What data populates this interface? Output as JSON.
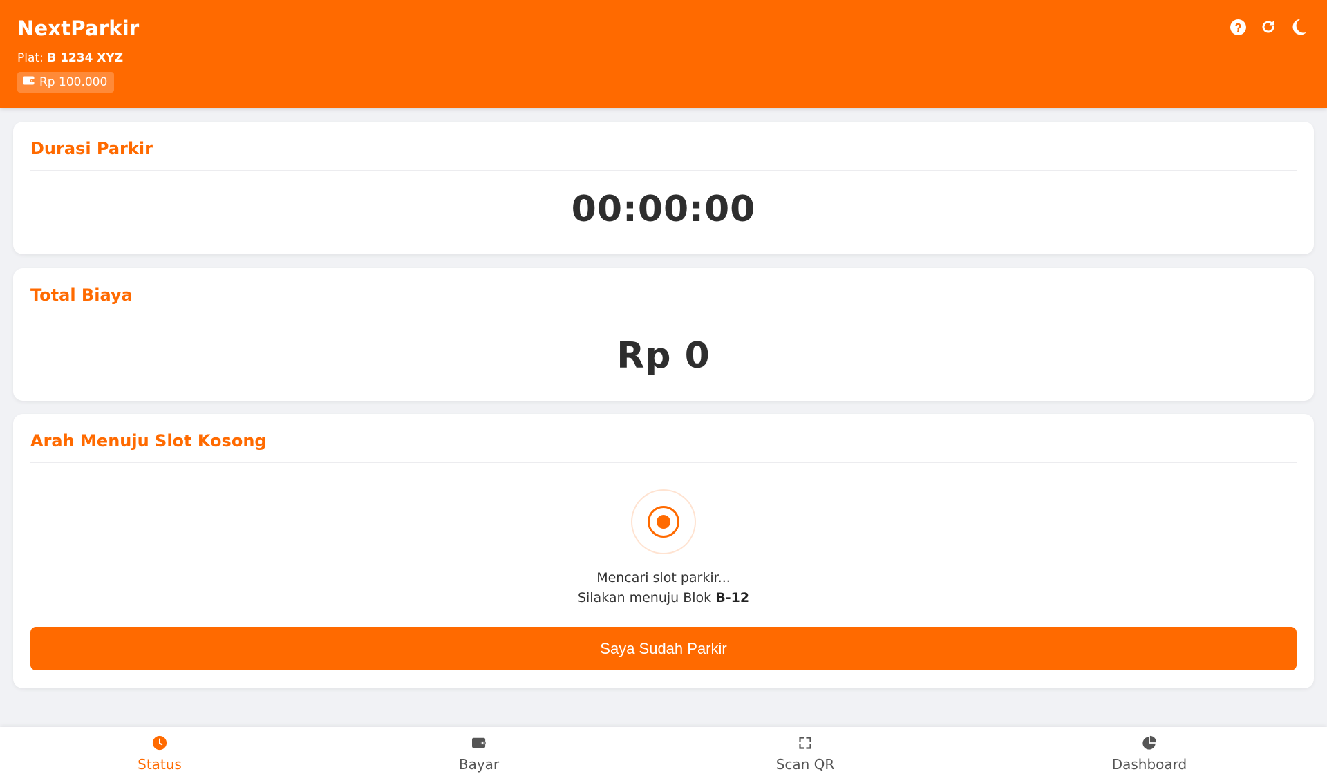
{
  "header": {
    "app_title": "NextParkir",
    "plate_label": "Plat:",
    "plate_number": "B 1234 XYZ",
    "balance": "Rp 100.000",
    "icons": [
      "help-icon",
      "refresh-icon",
      "dark-mode-icon"
    ]
  },
  "duration_card": {
    "title": "Durasi Parkir",
    "value": "00:00:00"
  },
  "cost_card": {
    "title": "Total Biaya",
    "value": "Rp 0"
  },
  "direction_card": {
    "title": "Arah Menuju Slot Kosong",
    "searching_text": "Mencari slot parkir...",
    "instruction_prefix": "Silakan menuju Blok",
    "block": "B-12",
    "button_label": "Saya Sudah Parkir"
  },
  "bottom_nav": {
    "items": [
      {
        "label": "Status",
        "icon": "clock-icon",
        "active": true
      },
      {
        "label": "Bayar",
        "icon": "wallet-icon",
        "active": false
      },
      {
        "label": "Scan QR",
        "icon": "scan-icon",
        "active": false
      },
      {
        "label": "Dashboard",
        "icon": "pie-chart-icon",
        "active": false
      }
    ]
  },
  "colors": {
    "primary": "#ff6a00",
    "background": "#f1f2f5",
    "card": "#ffffff",
    "text_dark": "#2e2e2e"
  }
}
